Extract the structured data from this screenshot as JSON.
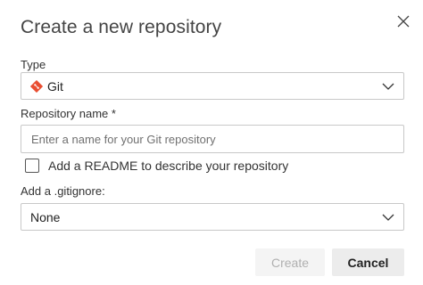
{
  "dialog": {
    "title": "Create a new repository",
    "close_icon": "close-icon"
  },
  "type_field": {
    "label": "Type",
    "selected": "Git",
    "icon": "git-icon",
    "icon_color": "#e94e31"
  },
  "repo_name_field": {
    "label": "Repository name *",
    "value": "",
    "placeholder": "Enter a name for your Git repository"
  },
  "readme_option": {
    "label": "Add a README to describe your repository",
    "checked": false
  },
  "gitignore_field": {
    "label": "Add a .gitignore:",
    "selected": "None"
  },
  "actions": {
    "create_label": "Create",
    "create_enabled": false,
    "cancel_label": "Cancel"
  }
}
